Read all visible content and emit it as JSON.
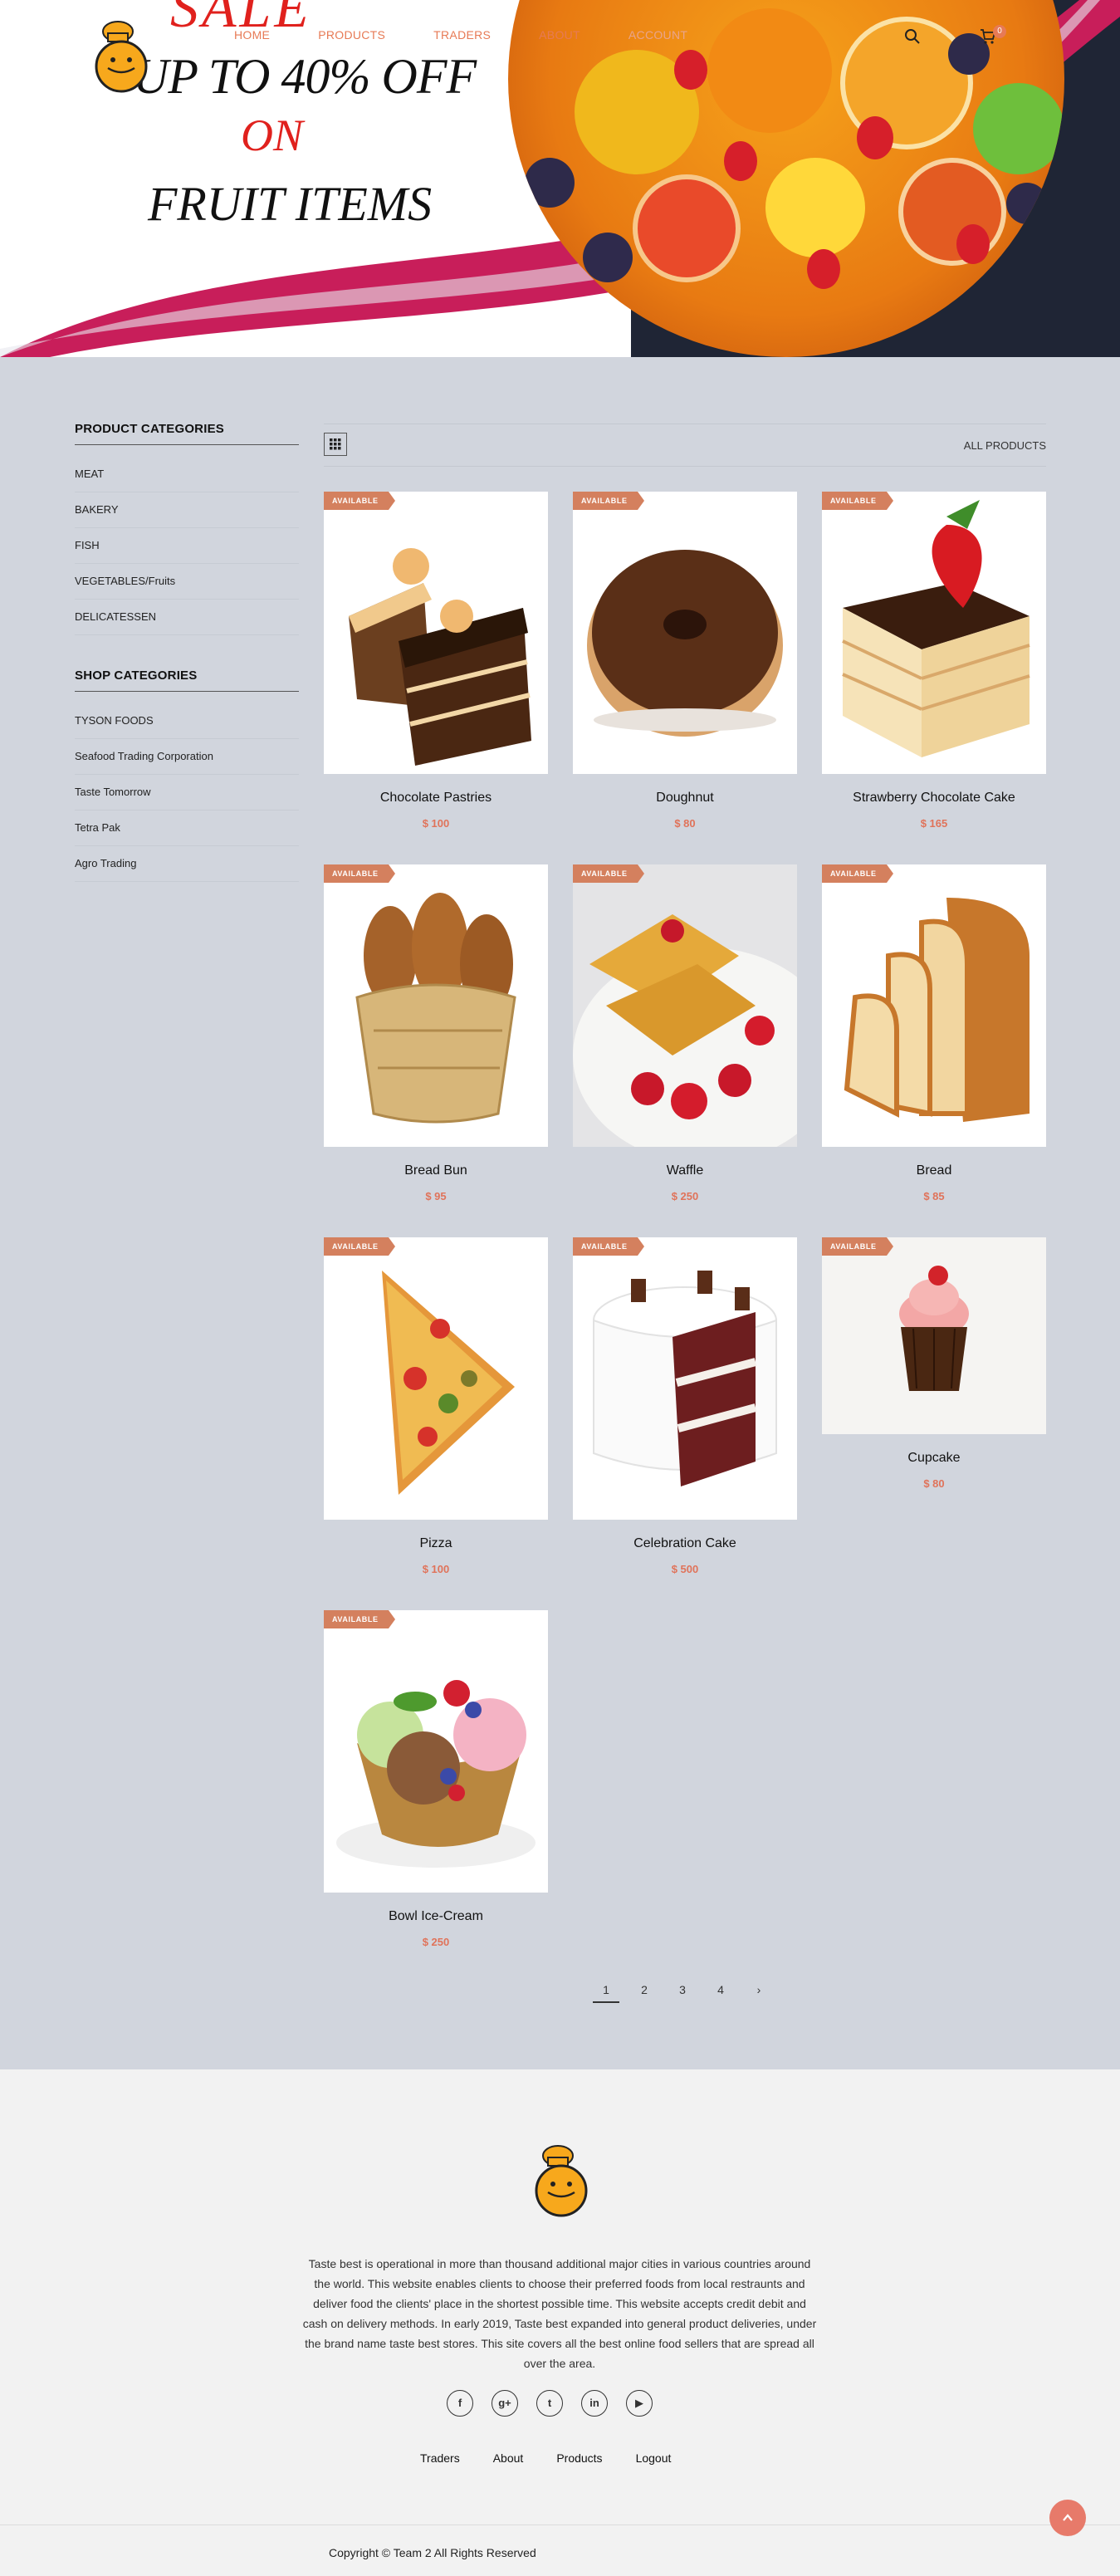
{
  "hero": {
    "sale_word": "SALE",
    "line1": "UP TO 40% OFF",
    "line2": "ON",
    "line3": "FRUIT ITEMS"
  },
  "nav": {
    "items": [
      "HOME",
      "PRODUCTS",
      "TRADERS",
      "ABOUT"
    ],
    "account": "ACCOUNT",
    "cart_count": "0"
  },
  "sidebar": {
    "product_categories_title": "PRODUCT CATEGORIES",
    "product_categories": [
      "MEAT",
      "BAKERY",
      "FISH",
      "VEGETABLES/Fruits",
      "DELICATESSEN"
    ],
    "shop_categories_title": "SHOP CATEGORIES",
    "shop_categories": [
      "TYSON FOODS",
      "Seafood Trading Corporation",
      "Taste Tomorrow",
      "Tetra Pak",
      "Agro Trading"
    ]
  },
  "toolbar": {
    "view_icon": "grid-icon",
    "filter_label": "ALL PRODUCTS"
  },
  "products": [
    {
      "badge": "AVAILABLE",
      "name": "Chocolate Pastries",
      "price": "$ 100"
    },
    {
      "badge": "AVAILABLE",
      "name": "Doughnut",
      "price": "$ 80"
    },
    {
      "badge": "AVAILABLE",
      "name": "Strawberry Chocolate Cake",
      "price": "$ 165"
    },
    {
      "badge": "AVAILABLE",
      "name": "Bread Bun",
      "price": "$ 95"
    },
    {
      "badge": "AVAILABLE",
      "name": "Waffle",
      "price": "$ 250"
    },
    {
      "badge": "AVAILABLE",
      "name": "Bread",
      "price": "$ 85"
    },
    {
      "badge": "AVAILABLE",
      "name": "Pizza",
      "price": "$ 100"
    },
    {
      "badge": "AVAILABLE",
      "name": "Celebration Cake",
      "price": "$ 500"
    },
    {
      "badge": "AVAILABLE",
      "name": "Cupcake",
      "price": "$ 80"
    },
    {
      "badge": "AVAILABLE",
      "name": "Bowl Ice-Cream",
      "price": "$ 250"
    }
  ],
  "pagination": {
    "pages": [
      "1",
      "2",
      "3",
      "4"
    ],
    "next": "›",
    "current": "1"
  },
  "footer": {
    "about": "Taste best is operational in more than thousand additional major cities in various countries around the world. This website enables clients to choose their preferred foods from local restraunts and deliver food the clients' place in the shortest possible time. This website accepts credit debit and cash on delivery methods. In early 2019, Taste best expanded into general product deliveries, under the brand name taste best stores. This site covers all the best online food sellers that are spread all over the area.",
    "socials": [
      "f",
      "g+",
      "t",
      "in",
      "▶"
    ],
    "links": [
      "Traders",
      "About",
      "Products",
      "Logout"
    ],
    "copyright": "Copyright © Team 2 All Rights Reserved"
  },
  "colors": {
    "accent": "#e77a55",
    "badge": "#d4805e",
    "price": "#e0735a",
    "page_bg": "#d1d5dd",
    "footer_bg": "#f2f2f2",
    "sale_red": "#e0211d"
  }
}
